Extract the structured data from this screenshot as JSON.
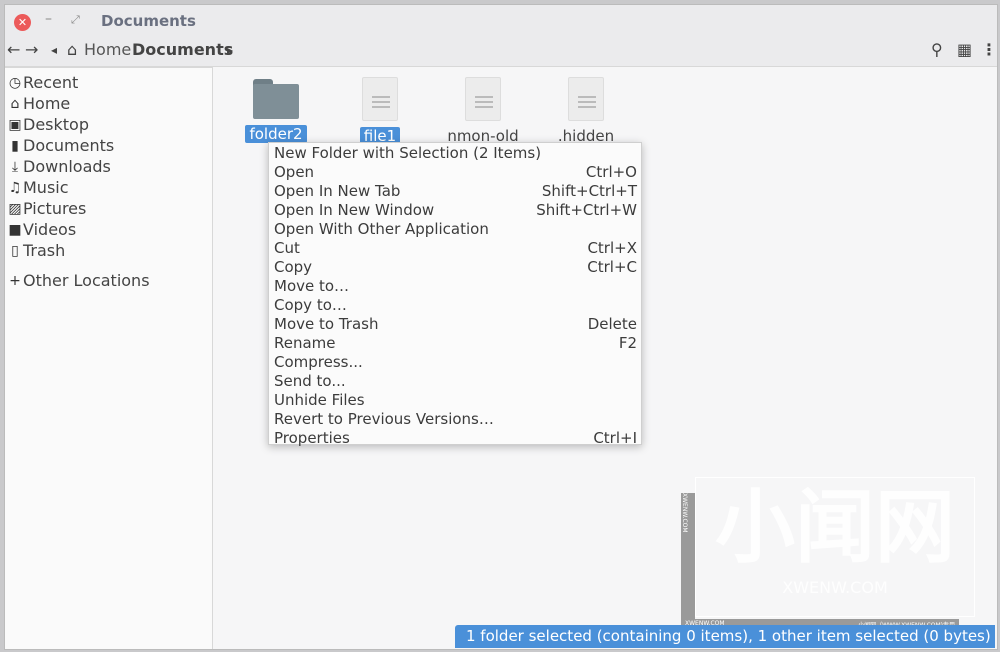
{
  "window": {
    "title": "Documents",
    "close_icon": "close-icon",
    "minimize_icon": "minimize-icon",
    "maximize_icon": "maximize-icon"
  },
  "toolbar": {
    "back": "←",
    "forward": "→",
    "crumb_left": "◂",
    "home_icon": "⌂",
    "crumbs": [
      "Home",
      "Documents"
    ],
    "crumb_right": "▸",
    "search": "⚲",
    "view": "▦",
    "menu": "⋮"
  },
  "sidebar": {
    "items": [
      {
        "icon": "◷",
        "label": "Recent"
      },
      {
        "icon": "⌂",
        "label": "Home"
      },
      {
        "icon": "▣",
        "label": "Desktop"
      },
      {
        "icon": "▮",
        "label": "Documents"
      },
      {
        "icon": "⤓",
        "label": "Downloads"
      },
      {
        "icon": "♫",
        "label": "Music"
      },
      {
        "icon": "▨",
        "label": "Pictures"
      },
      {
        "icon": "■",
        "label": "Videos"
      },
      {
        "icon": "▯",
        "label": "Trash"
      }
    ],
    "other": {
      "icon": "+",
      "label": "Other Locations"
    }
  },
  "files": [
    {
      "name": "folder2",
      "type": "folder",
      "selected": true
    },
    {
      "name": "file1",
      "type": "file",
      "selected": true
    },
    {
      "name": "nmon-old",
      "type": "file",
      "selected": false
    },
    {
      "name": ".hidden",
      "type": "file",
      "selected": false
    }
  ],
  "context_menu": [
    {
      "label": "New Folder with Selection (2 Items)",
      "shortcut": ""
    },
    {
      "label": "Open",
      "shortcut": "Ctrl+O"
    },
    {
      "label": "Open In New Tab",
      "shortcut": "Shift+Ctrl+T"
    },
    {
      "label": "Open In New Window",
      "shortcut": "Shift+Ctrl+W"
    },
    {
      "label": "Open With Other Application",
      "shortcut": ""
    },
    {
      "label": "Cut",
      "shortcut": "Ctrl+X"
    },
    {
      "label": "Copy",
      "shortcut": "Ctrl+C"
    },
    {
      "label": "Move to…",
      "shortcut": ""
    },
    {
      "label": "Copy to…",
      "shortcut": ""
    },
    {
      "label": "Move to Trash",
      "shortcut": "Delete"
    },
    {
      "label": "Rename",
      "shortcut": "F2"
    },
    {
      "label": "Compress...",
      "shortcut": ""
    },
    {
      "label": "Send to...",
      "shortcut": ""
    },
    {
      "label": "Unhide Files",
      "shortcut": ""
    },
    {
      "label": "Revert to Previous Versions…",
      "shortcut": ""
    },
    {
      "label": "Properties",
      "shortcut": "Ctrl+I"
    }
  ],
  "status": "1 folder selected (containing 0 items), 1 other item selected (0 bytes)",
  "watermark": {
    "big": "小闻网",
    "small": "XWENW.COM",
    "side": "XWENW.COM",
    "bottom_left": "XWENW.COM",
    "bottom_right": "小闻网（WWW.XWENW.COM)专用"
  },
  "colors": {
    "accent": "#4a90d9",
    "close": "#ec5a5a"
  }
}
